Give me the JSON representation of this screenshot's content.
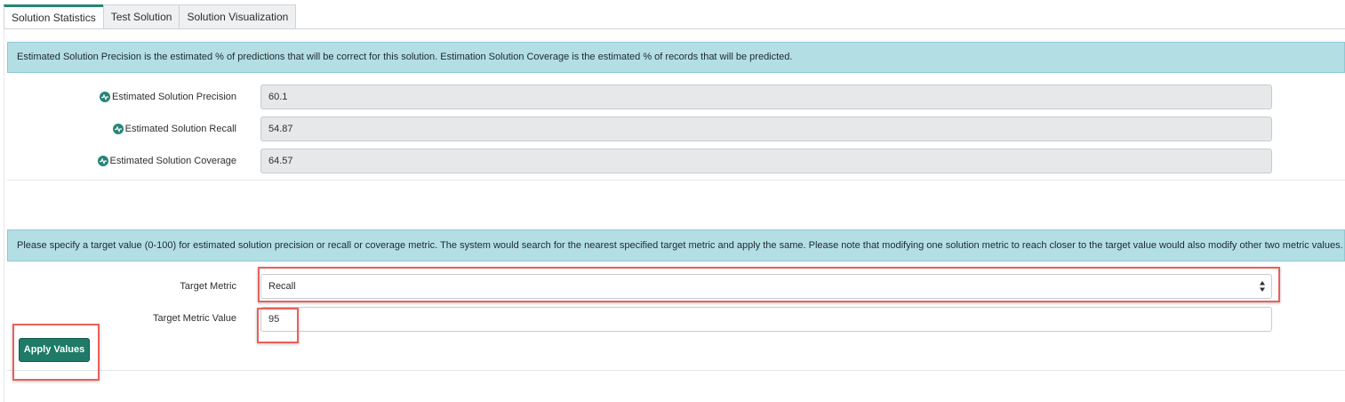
{
  "tabs": [
    {
      "label": "Solution Statistics",
      "active": true
    },
    {
      "label": "Test Solution",
      "active": false
    },
    {
      "label": "Solution Visualization",
      "active": false
    }
  ],
  "info_top": "Estimated Solution Precision is the estimated % of predictions that will be correct for this solution. Estimation Solution Coverage is the estimated % of records that will be predicted.",
  "stats": [
    {
      "label": "Estimated Solution Precision",
      "value": "60.1",
      "icon": "stat-pulse-icon"
    },
    {
      "label": "Estimated Solution Recall",
      "value": "54.87",
      "icon": "stat-pulse-icon"
    },
    {
      "label": "Estimated Solution Coverage",
      "value": "64.57",
      "icon": "stat-pulse-icon"
    }
  ],
  "info_bottom": "Please specify a target value (0-100) for estimated solution precision or recall or coverage metric. The system would search for the nearest specified target metric and apply the same. Please note that modifying one solution metric to reach closer to the target value would also modify other two metric values.",
  "target": {
    "metric_label": "Target Metric",
    "metric_selected": "Recall",
    "value_label": "Target Metric Value",
    "value": "95"
  },
  "apply_label": "Apply Values",
  "colors": {
    "accent": "#278575",
    "info_bg": "#b3dee4",
    "highlight": "#e8605a"
  }
}
